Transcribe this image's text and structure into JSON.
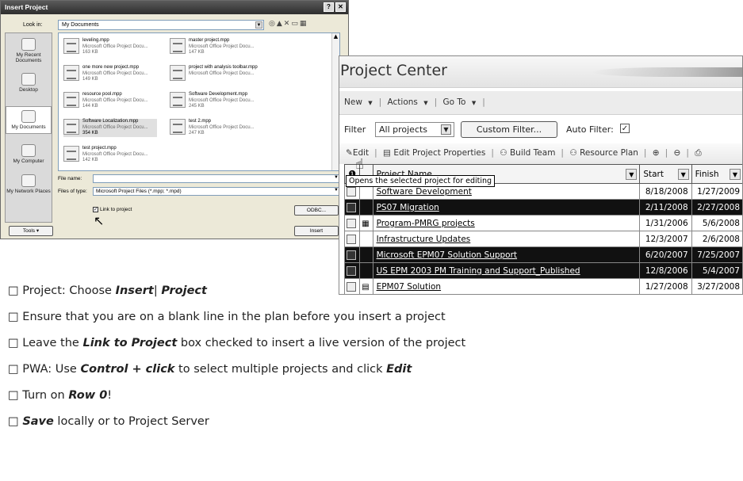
{
  "dialog": {
    "title": "Insert Project",
    "title_buttons": [
      "?",
      "✕"
    ],
    "look_in_label": "Look in:",
    "look_in_value": "My Documents",
    "places": [
      "My Recent Documents",
      "Desktop",
      "My Documents",
      "My Computer",
      "My Network Places"
    ],
    "files": [
      {
        "name": "leveling.mpp",
        "type": "Microsoft Office Project Docu...",
        "size": "163 KB"
      },
      {
        "name": "master project.mpp",
        "type": "Microsoft Office Project Docu...",
        "size": "147 KB"
      },
      {
        "name": "one more new project.mpp",
        "type": "Microsoft Office Project Docu...",
        "size": "149 KB"
      },
      {
        "name": "project with analysis toolbar.mpp",
        "type": "Microsoft Office Project Docu...",
        "size": ""
      },
      {
        "name": "resource pool.mpp",
        "type": "Microsoft Office Project Docu...",
        "size": "144 KB"
      },
      {
        "name": "Software Development.mpp",
        "type": "Microsoft Office Project Docu...",
        "size": "245 KB"
      },
      {
        "name": "Software Localization.mpp",
        "type": "Microsoft Office Project Docu...",
        "size": "354 KB"
      },
      {
        "name": "test 2.mpp",
        "type": "Microsoft Office Project Docu...",
        "size": "247 KB"
      },
      {
        "name": "test project.mpp",
        "type": "Microsoft Office Project Docu...",
        "size": "142 KB"
      }
    ],
    "file_name_label": "File name:",
    "file_name_value": "",
    "files_of_type_label": "Files of type:",
    "files_of_type_value": "Microsoft Project Files (*.mpp; *.mpd)",
    "link_checkbox_label": "Link to project",
    "link_checked": true,
    "odbc_button": "ODBC...",
    "tools_button": "Tools",
    "insert_button": "Insert"
  },
  "project_center": {
    "title": "Project Center",
    "menu": [
      "New",
      "Actions",
      "Go To"
    ],
    "filter_label": "Filter",
    "filter_value": "All projects",
    "custom_filter_button": "Custom Filter...",
    "auto_filter_label": "Auto Filter:",
    "auto_filter_checked": true,
    "toolbar": [
      "Edit",
      "Edit Project Properties",
      "Build Team",
      "Resource Plan"
    ],
    "tooltip": "Opens the selected project for editing",
    "columns": [
      "Project Name",
      "Start",
      "Finish"
    ],
    "rows": [
      {
        "name": "Software Development",
        "start": "8/18/2008",
        "finish": "1/27/2009",
        "selected": false
      },
      {
        "name": "PS07 Migration",
        "start": "2/11/2008",
        "finish": "2/27/2008",
        "selected": true
      },
      {
        "name": "Program-PMRG projects",
        "start": "1/31/2006",
        "finish": "5/6/2008",
        "selected": false
      },
      {
        "name": "Infrastructure Updates",
        "start": "12/3/2007",
        "finish": "2/6/2008",
        "selected": false
      },
      {
        "name": "Microsoft EPM07 Solution Support",
        "start": "6/20/2007",
        "finish": "7/25/2007",
        "selected": true
      },
      {
        "name": "US EPM 2003 PM Training and Support_Published",
        "start": "12/8/2006",
        "finish": "5/4/2007",
        "selected": true
      },
      {
        "name": "EPM07 Solution",
        "start": "1/27/2008",
        "finish": "3/27/2008",
        "selected": false
      }
    ]
  },
  "bullets": [
    {
      "pre": "□ Project: Choose ",
      "bold": "Insert",
      "mid": "| ",
      "bold2": "Project",
      "post": ""
    },
    {
      "pre": "□ Ensure that you are on a blank line in the plan before you insert a project",
      "bold": "",
      "mid": "",
      "bold2": "",
      "post": ""
    },
    {
      "pre": "□ Leave the ",
      "bold": "Link to Project",
      "mid": " box checked to insert a live version of the project",
      "bold2": "",
      "post": ""
    },
    {
      "pre": "□ PWA: Use ",
      "bold": "Control + click",
      "mid": " to select multiple projects and click ",
      "bold2": "Edit",
      "post": ""
    },
    {
      "pre": "□ Turn on ",
      "bold": "Row 0",
      "mid": "!",
      "bold2": "",
      "post": ""
    },
    {
      "pre": "□ ",
      "bold": "Save",
      "mid": " locally or to Project Server",
      "bold2": "",
      "post": ""
    }
  ]
}
